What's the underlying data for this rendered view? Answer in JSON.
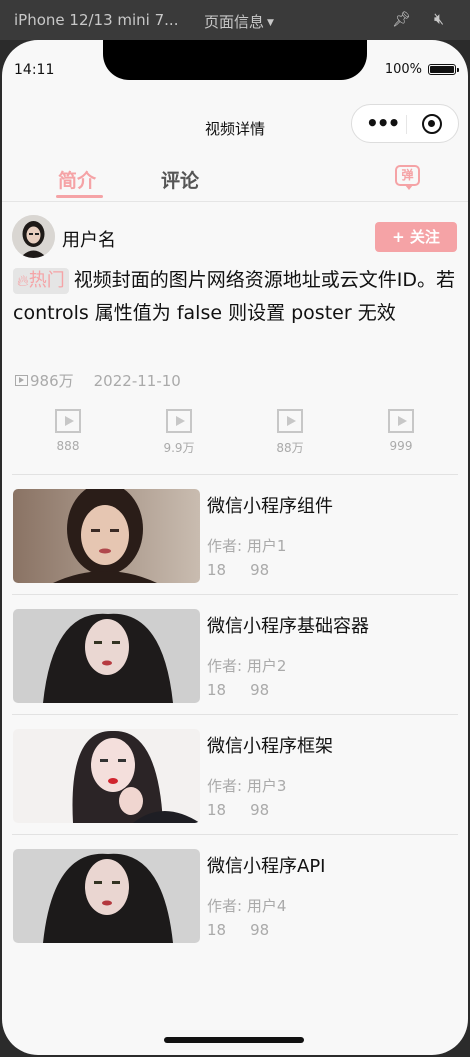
{
  "devtools": {
    "device": "iPhone 12/13 mini 7...",
    "page_info": "页面信息"
  },
  "status_bar": {
    "time": "14:11",
    "battery": "100%"
  },
  "navbar": {
    "title": "视频详情"
  },
  "tabs": [
    {
      "label": "简介",
      "active": true
    },
    {
      "label": "评论",
      "active": false
    }
  ],
  "danmu_icon": "弹",
  "author": {
    "name": "用户名",
    "follow_label": "+ 关注"
  },
  "video": {
    "badge": "热门",
    "description": "视频封面的图片网络资源地址或云文件ID。若 controls 属性值为 false 则设置 poster 无效",
    "views": "986万",
    "date": "2022-11-10"
  },
  "stats": [
    "888",
    "9.9万",
    "88万",
    "999"
  ],
  "related": [
    {
      "title": "微信小程序组件",
      "author": "作者: 用户1",
      "a": "18",
      "b": "98"
    },
    {
      "title": "微信小程序基础容器",
      "author": "作者: 用户2",
      "a": "18",
      "b": "98"
    },
    {
      "title": "微信小程序框架",
      "author": "作者: 用户3",
      "a": "18",
      "b": "98"
    },
    {
      "title": "微信小程序API",
      "author": "作者: 用户4",
      "a": "18",
      "b": "98"
    }
  ],
  "colors": {
    "accent": "#f5a3a6",
    "muted": "#aaaaaa"
  }
}
